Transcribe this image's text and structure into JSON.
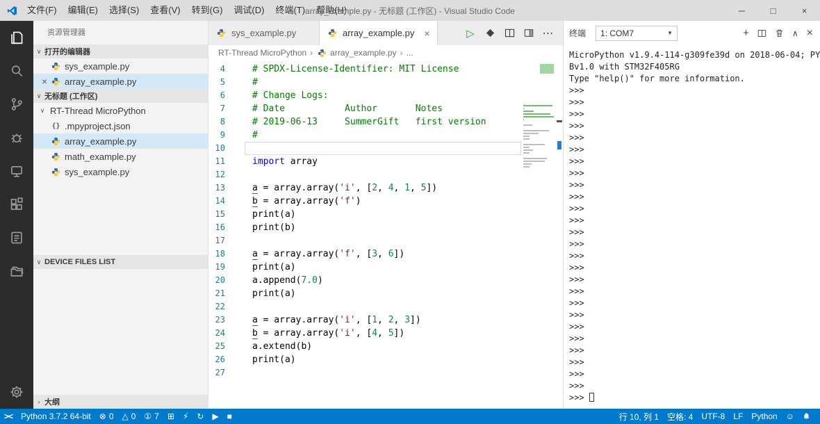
{
  "colors": {
    "accent": "#007acc",
    "statusbar": "#007acc",
    "titlebar": "#dddddd",
    "activitybar": "#2c2c2c",
    "sidebar": "#f3f3f3",
    "selection": "#d3e8f8",
    "comment": "#008000",
    "keyword": "#0000ff",
    "string": "#a31515",
    "number": "#098658"
  },
  "titlebar": {
    "menus": [
      "文件(F)",
      "编辑(E)",
      "选择(S)",
      "查看(V)",
      "转到(G)",
      "调试(D)",
      "终端(T)",
      "帮助(H)"
    ],
    "title": "array_example.py - 无标题 (工作区) - Visual Studio Code",
    "controls": {
      "minimize": "─",
      "maximize": "□",
      "close": "×"
    }
  },
  "sidebar": {
    "title": "资源管理器",
    "open_editors": {
      "header": "打开的编辑器",
      "items": [
        {
          "label": "sys_example.py",
          "icon": "python",
          "active": false,
          "close": ""
        },
        {
          "label": "array_example.py",
          "icon": "python",
          "active": true,
          "close": "×"
        }
      ]
    },
    "workspace": {
      "header": "无标题 (工作区)",
      "folder": "RT-Thread MicroPython",
      "files": [
        {
          "name": ".mpyproject.json",
          "icon": "json",
          "selected": false
        },
        {
          "name": "array_example.py",
          "icon": "python",
          "selected": true
        },
        {
          "name": "math_example.py",
          "icon": "python",
          "selected": false
        },
        {
          "name": "sys_example.py",
          "icon": "python",
          "selected": false
        }
      ]
    },
    "device_files_header": "DEVICE FILES LIST",
    "outline_header": "大纲"
  },
  "editor": {
    "tabs": [
      {
        "label": "sys_example.py",
        "icon": "python",
        "active": false,
        "close": ""
      },
      {
        "label": "array_example.py",
        "icon": "python",
        "active": true,
        "close": "×"
      }
    ],
    "breadcrumb": [
      {
        "label": "RT-Thread MicroPython"
      },
      {
        "label": "array_example.py",
        "icon": "python"
      },
      {
        "label": "..."
      }
    ],
    "cursor": {
      "line": 10,
      "col": 1
    },
    "code": [
      {
        "n": 4,
        "t": [
          [
            "c",
            "# SPDX-License-Identifier: MIT License"
          ]
        ]
      },
      {
        "n": 5,
        "t": [
          [
            "c",
            "#"
          ]
        ]
      },
      {
        "n": 6,
        "t": [
          [
            "c",
            "# Change Logs:"
          ]
        ]
      },
      {
        "n": 7,
        "t": [
          [
            "c",
            "# Date           Author       Notes"
          ]
        ]
      },
      {
        "n": 8,
        "t": [
          [
            "c",
            "# 2019-06-13     SummerGift   first version"
          ]
        ]
      },
      {
        "n": 9,
        "t": [
          [
            "c",
            "#"
          ]
        ]
      },
      {
        "n": 10,
        "t": [],
        "current": true
      },
      {
        "n": 11,
        "t": [
          [
            "k",
            "import"
          ],
          [
            "p",
            " array"
          ]
        ]
      },
      {
        "n": 12,
        "t": []
      },
      {
        "n": 13,
        "t": [
          [
            "v",
            "a"
          ],
          [
            "p",
            " = array.array("
          ],
          [
            "s",
            "'i'"
          ],
          [
            "p",
            ", ["
          ],
          [
            "num",
            "2"
          ],
          [
            "p",
            ", "
          ],
          [
            "num",
            "4"
          ],
          [
            "p",
            ", "
          ],
          [
            "num",
            "1"
          ],
          [
            "p",
            ", "
          ],
          [
            "num",
            "5"
          ],
          [
            "p",
            "])"
          ]
        ]
      },
      {
        "n": 14,
        "t": [
          [
            "v",
            "b"
          ],
          [
            "p",
            " = array.array("
          ],
          [
            "s",
            "'f'"
          ],
          [
            "p",
            ")"
          ]
        ]
      },
      {
        "n": 15,
        "t": [
          [
            "p",
            "print(a)"
          ]
        ]
      },
      {
        "n": 16,
        "t": [
          [
            "p",
            "print(b)"
          ]
        ]
      },
      {
        "n": 17,
        "t": []
      },
      {
        "n": 18,
        "t": [
          [
            "v",
            "a"
          ],
          [
            "p",
            " = array.array("
          ],
          [
            "s",
            "'f'"
          ],
          [
            "p",
            ", ["
          ],
          [
            "num",
            "3"
          ],
          [
            "p",
            ", "
          ],
          [
            "num",
            "6"
          ],
          [
            "p",
            "])"
          ]
        ]
      },
      {
        "n": 19,
        "t": [
          [
            "p",
            "print(a)"
          ]
        ]
      },
      {
        "n": 20,
        "t": [
          [
            "p",
            "a.append("
          ],
          [
            "num",
            "7.0"
          ],
          [
            "p",
            ")"
          ]
        ]
      },
      {
        "n": 21,
        "t": [
          [
            "p",
            "print(a)"
          ]
        ]
      },
      {
        "n": 22,
        "t": []
      },
      {
        "n": 23,
        "t": [
          [
            "v",
            "a"
          ],
          [
            "p",
            " = array.array("
          ],
          [
            "s",
            "'i'"
          ],
          [
            "p",
            ", ["
          ],
          [
            "num",
            "1"
          ],
          [
            "p",
            ", "
          ],
          [
            "num",
            "2"
          ],
          [
            "p",
            ", "
          ],
          [
            "num",
            "3"
          ],
          [
            "p",
            "])"
          ]
        ]
      },
      {
        "n": 24,
        "t": [
          [
            "v",
            "b"
          ],
          [
            "p",
            " = array.array("
          ],
          [
            "s",
            "'i'"
          ],
          [
            "p",
            ", ["
          ],
          [
            "num",
            "4"
          ],
          [
            "p",
            ", "
          ],
          [
            "num",
            "5"
          ],
          [
            "p",
            "])"
          ]
        ]
      },
      {
        "n": 25,
        "t": [
          [
            "p",
            "a.extend(b)"
          ]
        ]
      },
      {
        "n": 26,
        "t": [
          [
            "p",
            "print(a)"
          ]
        ]
      },
      {
        "n": 27,
        "t": []
      }
    ]
  },
  "terminal": {
    "title": "终端",
    "dropdown": "1: COM7",
    "banner": [
      "MicroPython v1.9.4-114-g309fe39d on 2018-06-04; PY",
      "Bv1.0 with STM32F405RG",
      "Type \"help()\" for more information."
    ],
    "prompt": ">>>",
    "prompt_repeat": 26
  },
  "statusbar": {
    "left": [
      {
        "icon": "remote",
        "name": "remote-indicator"
      },
      {
        "text": "Python 3.7.2 64-bit",
        "name": "python-interpreter"
      },
      {
        "icon": "error",
        "text": "0",
        "name": "problems-errors"
      },
      {
        "icon": "warning",
        "text": "0",
        "name": "problems-warnings"
      },
      {
        "icon": "info",
        "text": "7",
        "name": "notifications-count"
      },
      {
        "icon": "board",
        "name": "download-board-button"
      },
      {
        "icon": "flash",
        "name": "flash-button"
      },
      {
        "icon": "sync",
        "name": "sync-button"
      },
      {
        "icon": "run",
        "name": "run-button"
      },
      {
        "icon": "stop",
        "name": "stop-button"
      }
    ],
    "right": [
      {
        "text": "行 10, 列 1",
        "name": "cursor-position"
      },
      {
        "text": "空格: 4",
        "name": "indentation"
      },
      {
        "text": "UTF-8",
        "name": "encoding"
      },
      {
        "text": "LF",
        "name": "eol"
      },
      {
        "text": "Python",
        "name": "language-mode"
      },
      {
        "icon": "smiley",
        "name": "feedback-button"
      },
      {
        "icon": "bell",
        "name": "notifications-bell"
      }
    ]
  }
}
